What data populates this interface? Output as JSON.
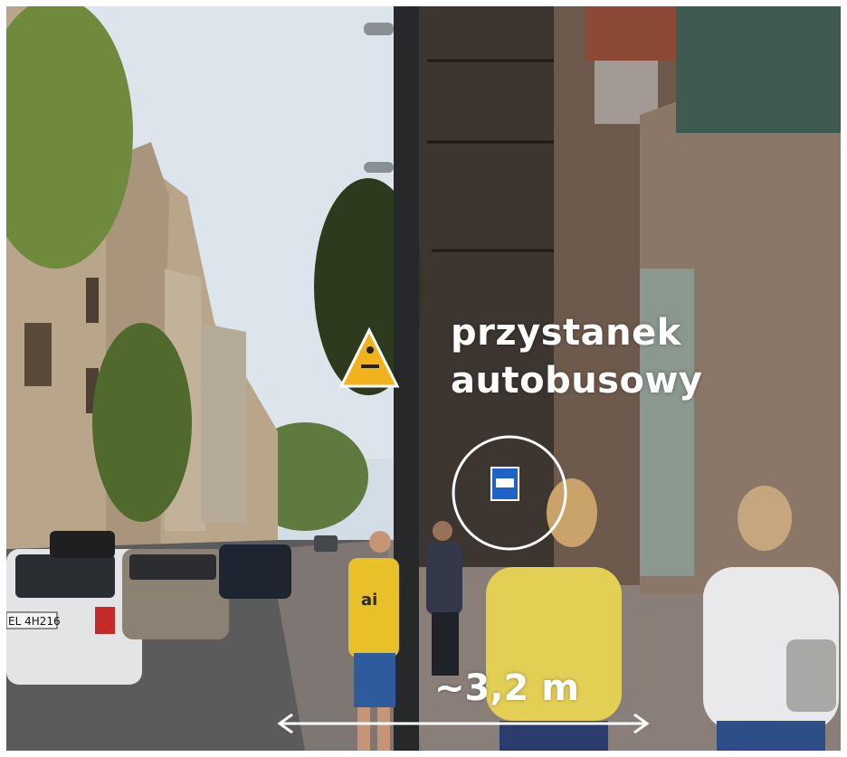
{
  "overlay": {
    "label_line1": "przystanek",
    "label_line2": "autobusowy",
    "distance_label": "~3,2 m",
    "overlay_color": "#ffffff"
  },
  "scene": {
    "plate_text": "EL 4H216",
    "shirt_text": "ai"
  }
}
